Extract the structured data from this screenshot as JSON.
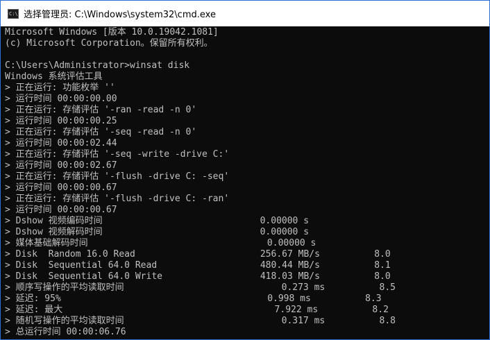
{
  "window": {
    "title": "选择管理员: C:\\Windows\\system32\\cmd.exe",
    "icon": "cmd-icon",
    "icon_text": "C:\\",
    "colors": {
      "console_background": "#0c0c0c",
      "console_text": "#c0c0c0",
      "titlebar_background": "#ffffff",
      "border": "#2b6fd6"
    }
  },
  "console": {
    "lines": [
      "Microsoft Windows [版本 10.0.19042.1081]",
      "(c) Microsoft Corporation。保留所有权利。",
      "",
      "C:\\Users\\Administrator>winsat disk",
      "Windows 系统评估工具",
      "> 正在运行: 功能枚举 ''",
      "> 运行时间 00:00:00.00",
      "> 正在运行: 存储评估 '-ran -read -n 0'",
      "> 运行时间 00:00:00.25",
      "> 正在运行: 存储评估 '-seq -read -n 0'",
      "> 运行时间 00:00:02.44",
      "> 正在运行: 存储评估 '-seq -write -drive C:'",
      "> 运行时间 00:00:02.67",
      "> 正在运行: 存储评估 '-flush -drive C: -seq'",
      "> 运行时间 00:00:00.67",
      "> 正在运行: 存储评估 '-flush -drive C: -ran'",
      "> 运行时间 00:00:00.67",
      "> Dshow 视频编码时间                             0.00000 s",
      "> Dshow 视频解码时间                             0.00000 s",
      "> 媒体基础解码时间                                 0.00000 s",
      "> Disk  Random 16.0 Read                       256.67 MB/s          8.0",
      "> Disk  Sequential 64.0 Read                   480.44 MB/s          8.1",
      "> Disk  Sequential 64.0 Write                  418.03 MB/s          8.0",
      "> 顺序写操作的平均读取时间                             0.273 ms          8.5",
      "> 延迟: 95%                                      0.998 ms          8.3",
      "> 延迟: 最大                                       7.922 ms          8.2",
      "> 随机写操作的平均读取时间                             0.317 ms          8.8",
      "> 总运行时间 00:00:06.76"
    ]
  }
}
